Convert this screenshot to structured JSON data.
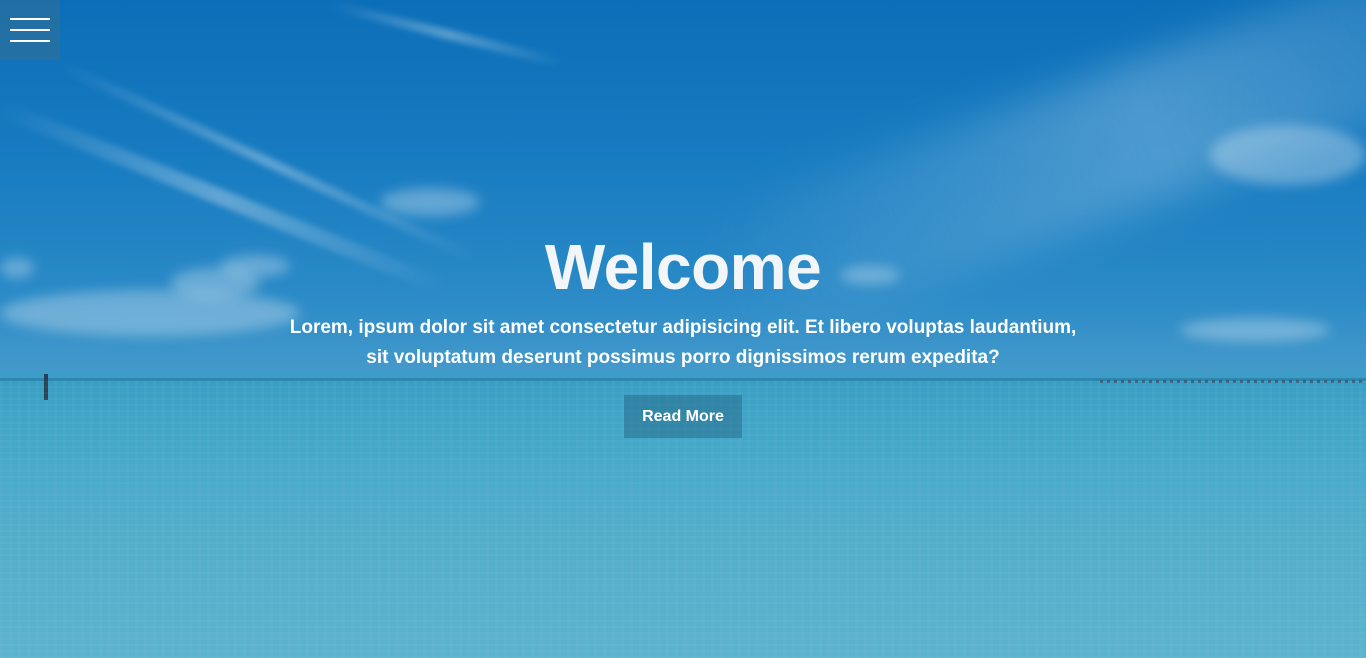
{
  "menu": {
    "icon": "hamburger-menu-icon"
  },
  "hero": {
    "title": "Welcome",
    "subtitle": "Lorem, ipsum dolor sit amet consectetur adipisicing elit. Et libero voluptas laudantium, sit voluptatum deserunt possimus porro dignissimos rerum expedita?",
    "button_label": "Read More"
  },
  "colors": {
    "sky": "#0b6fba",
    "sea": "#5ab7cf",
    "button_bg": "#3a7e96",
    "text": "#ffffff"
  }
}
